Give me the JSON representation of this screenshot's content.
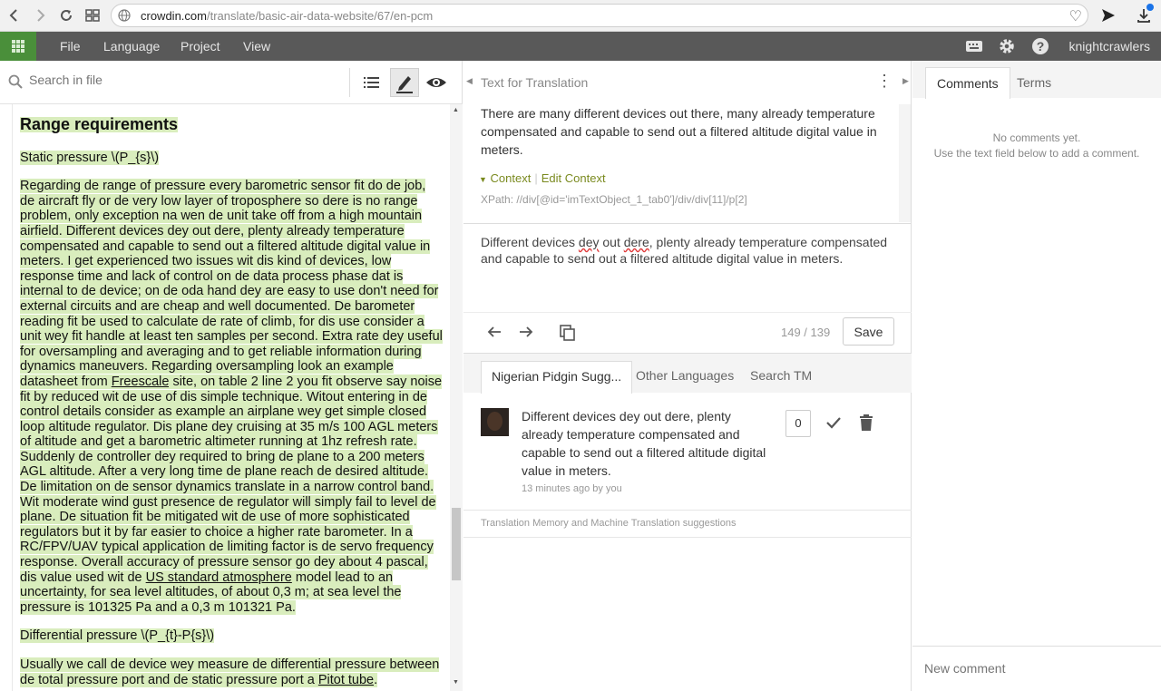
{
  "browser": {
    "url_host": "crowdin.com",
    "url_path": "/translate/basic-air-data-website/67/en-pcm"
  },
  "header": {
    "menu": [
      "File",
      "Language",
      "Project",
      "View"
    ],
    "user": "knightcrawlers"
  },
  "left": {
    "search_placeholder": "Search in file",
    "doc": {
      "heading": "Range requirements",
      "static_pressure": "Static pressure \\(P_{s}\\)",
      "para1_a": "Regarding de range of pressure every barometric sensor fit do de job, de aircraft fly or de very low layer of troposphere so dere is no range problem, only exception na wen de unit take off from a high mountain airfield.",
      "para1_b": " Different devices dey out dere, plenty already temperature compensated and capable to send out a filtered altitude digital value in meters.",
      "para1_c": " I get experienced two issues wit dis kind of devices, low response time and lack of control on de data process phase dat is internal to de device; on de oda hand dey are easy to use don't need for external circuits and are cheap and well documented.",
      "para1_d": " De barometer reading fit be used to calculate de rate of climb, for dis use consider a unit wey fit handle at least ten samples per second.",
      "para1_e": " Extra rate dey useful for oversampling and averaging and to get reliable information during dynamics maneuvers.",
      "para1_f": " Regarding oversampling look an example datasheet from ",
      "freescale": "Freescale",
      "para1_g": " site, on table 2 line 2 you fit observe say noise fit by reduced wit de use of dis simple technique.",
      "para1_h": " Witout entering in de control details consider as example an airplane wey get simple closed loop altitude regulator.",
      "para1_i": " Dis plane dey cruising at 35 m/s 100 AGL meters of altitude and get a barometric altimeter running at 1hz refresh rate.",
      "para1_j": " Suddenly de controller dey required to bring de plane to a 200 meters AGL altitude.",
      "para1_k": " After a very long time de plane reach de desired altitude.",
      "para1_l": " De limitation on de sensor dynamics translate in a narrow control band.",
      "para1_m": " Wit moderate wind gust presence de regulator will simply fail to level de plane.",
      "para1_n": " De situation fit be mitigated wit de use of more sophisticated regulators but it by far easier to choice a higher rate barometer.",
      "para1_o": " In a RC/FPV/UAV typical application de limiting factor is de servo frequency response.",
      "para1_p": " Overall accuracy of pressure sensor go dey about 4 pascal, dis value used wit de ",
      "us_atm": "US standard atmosphere",
      "para1_q": " model lead to an uncertainty, for sea level altitudes, of about 0,3 m; at sea level the pressure is 101325 Pa and a 0,3 m 101321 Pa.",
      "diff_pressure": "Differential pressure \\(P_{t}-P{s}\\)",
      "para2_a": "Usually we call de device wey measure de differential pressure between de total pressure port and de static pressure port a ",
      "pitot": "Pitot tube",
      "para2_b": "."
    }
  },
  "middle": {
    "title": "Text for Translation",
    "source": "There are many different devices out there, many already temperature compensated and capable to send out a filtered altitude digital value in meters.",
    "context_label": "Context",
    "edit_context_label": "Edit Context",
    "xpath": "XPath: //div[@id='imTextObject_1_tab0']/div/div[11]/p[2]",
    "translation_a": "Different devices ",
    "translation_dey": "dey",
    "translation_b": " out ",
    "translation_dere": "dere",
    "translation_c": ", plenty already temperature compensated and capable to send out a filtered altitude digital value in meters.",
    "counter": "149 / 139",
    "save_label": "Save",
    "tabs": [
      "Nigerian Pidgin Sugg...",
      "Other Languages",
      "Search TM"
    ],
    "suggestion": {
      "text": "Different devices dey out dere, plenty already temperature compensated and capable to send out a filtered altitude digital value in meters.",
      "meta": "13 minutes ago by you",
      "votes": "0"
    },
    "tm_note": "Translation Memory and Machine Translation suggestions"
  },
  "right": {
    "tabs": [
      "Comments",
      "Terms"
    ],
    "no_comments_1": "No comments yet.",
    "no_comments_2": "Use the text field below to add a comment.",
    "new_comment_placeholder": "New comment"
  },
  "colors": {
    "accent_green": "#4a8f3a",
    "highlight": "#d9edbd",
    "header_gray": "#595959",
    "context_olive": "#7a8a1f"
  }
}
